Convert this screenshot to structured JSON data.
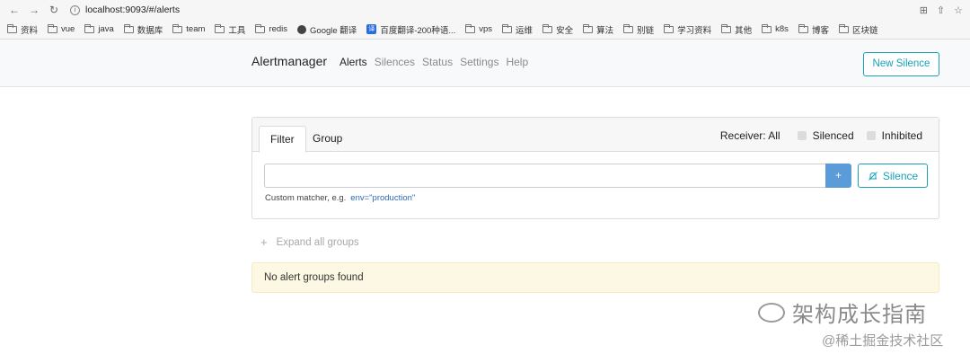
{
  "browser": {
    "url": "localhost:9093/#/alerts",
    "bookmarks": [
      "资料",
      "vue",
      "java",
      "数据库",
      "team",
      "工具",
      "redis",
      "Google 翻译",
      "百度翻译-200种语...",
      "vps",
      "运维",
      "安全",
      "算法",
      "别链",
      "学习资料",
      "其他",
      "k8s",
      "博客",
      "区块链"
    ]
  },
  "navbar": {
    "brand": "Alertmanager",
    "links": [
      "Alerts",
      "Silences",
      "Status",
      "Settings",
      "Help"
    ],
    "new_silence": "New Silence"
  },
  "panel": {
    "tabs": [
      "Filter",
      "Group"
    ],
    "receiver": "Receiver: All",
    "silenced": "Silenced",
    "inhibited": "Inhibited",
    "plus": "+",
    "silence_button": "Silence",
    "hint": "Custom matcher, e.g.",
    "hint_example": "env=\"production\""
  },
  "expand_all": "Expand all groups",
  "alert_message": "No alert groups found",
  "watermark": {
    "line1": "架构成长指南",
    "line2": "@稀土掘金技术社区"
  }
}
